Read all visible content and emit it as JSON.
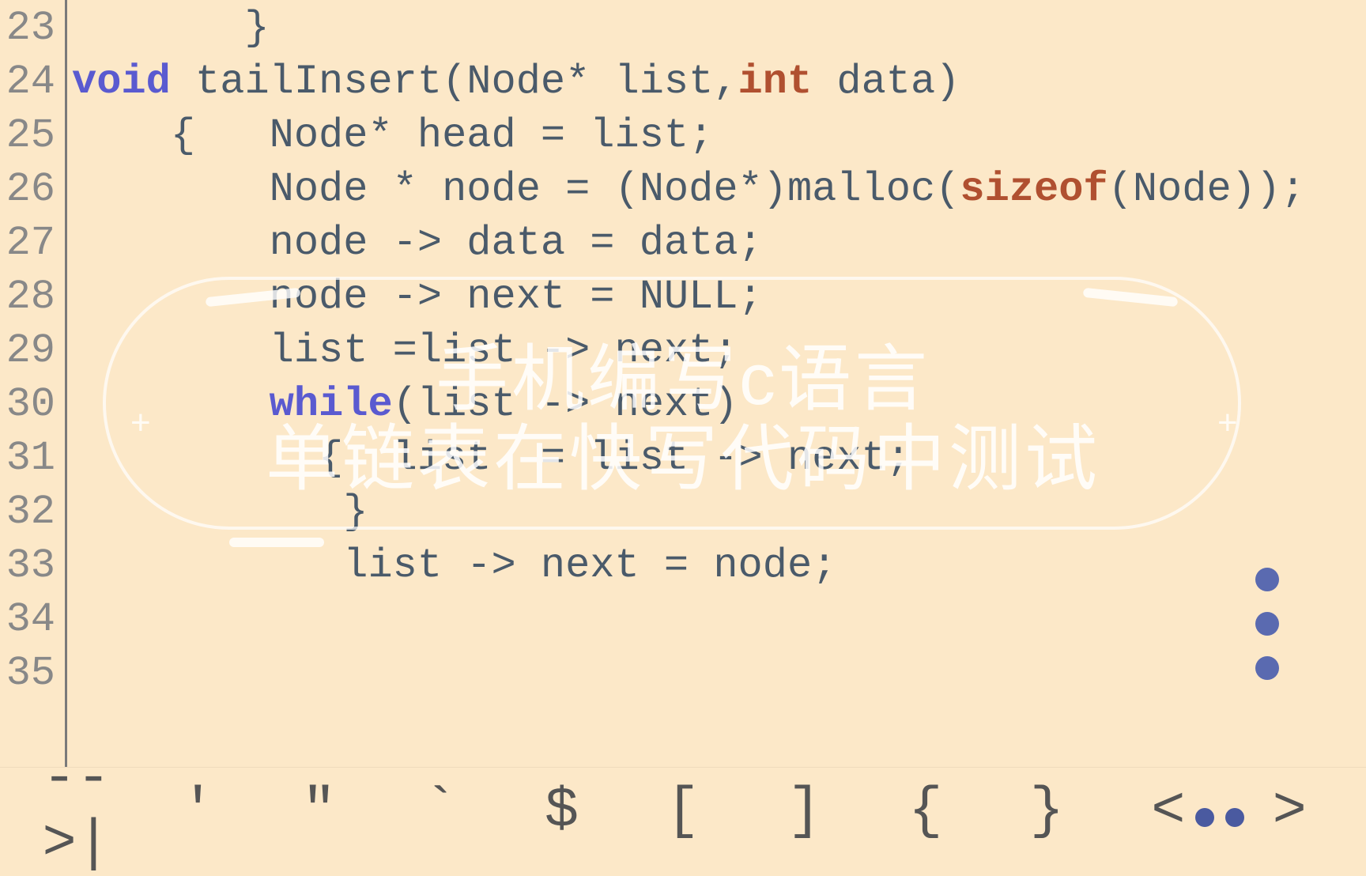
{
  "line_numbers": [
    "23",
    "24",
    "25",
    "26",
    "27",
    "28",
    "29",
    "30",
    "31",
    "32",
    "33",
    "34",
    "35"
  ],
  "code": {
    "l23": "       }",
    "l24": "",
    "l25_kw": "void",
    "l25_rest": " tailInsert(Node* list,",
    "l25_kw2": "int",
    "l25_rest2": " data)",
    "l26": "    {   Node* head = list;",
    "l27a": "        Node * node = (Node*)malloc(",
    "l27_kw": "sizeof",
    "l27b": "(Node));",
    "l28": "        node -> data = data;",
    "l29": "        node -> next = NULL;",
    "l30": "        list =list -> next;",
    "l31_kw": "while",
    "l31_rest": "(list -> next)",
    "l31_pre": "        ",
    "l32": "          {  list  = list -> next;",
    "l33": "",
    "l34": "           }",
    "l35": "           list -> next = node;"
  },
  "toolbar": {
    "k1": "-->|",
    "k2": "'",
    "k3": "\"",
    "k4": "`",
    "k5": "$",
    "k6": "[",
    "k7": "]",
    "k8": "{",
    "k9": "}",
    "k10": "<",
    "k11": ">"
  },
  "overlay": {
    "line1": "手机编写c语言",
    "line2": "单链表在快写代码中测试",
    "plus": "+"
  }
}
